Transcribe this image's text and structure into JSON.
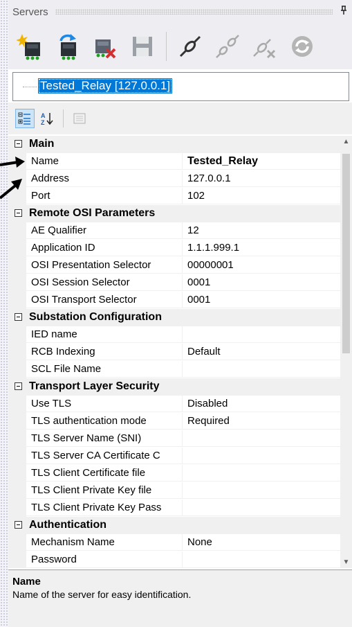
{
  "panel": {
    "title": "Servers",
    "pin_icon": "pin-icon"
  },
  "toolbar": {
    "buttons": [
      {
        "name": "new-server",
        "icon": "new-server-icon"
      },
      {
        "name": "import-server",
        "icon": "import-server-icon"
      },
      {
        "name": "delete-server",
        "icon": "delete-server-icon"
      },
      {
        "name": "save",
        "icon": "save-icon"
      },
      {
        "name": "connect",
        "icon": "connect-icon"
      },
      {
        "name": "connect-all",
        "icon": "connect-all-icon"
      },
      {
        "name": "disconnect",
        "icon": "disconnect-icon"
      },
      {
        "name": "refresh",
        "icon": "refresh-icon"
      }
    ]
  },
  "tree": {
    "selected_node": "Tested_Relay [127.0.0.1]"
  },
  "grid": {
    "categories": [
      {
        "label": "Main",
        "properties": [
          {
            "name": "Name",
            "value": "Tested_Relay",
            "bold": true
          },
          {
            "name": "Address",
            "value": "127.0.0.1"
          },
          {
            "name": "Port",
            "value": "102"
          }
        ]
      },
      {
        "label": "Remote OSI Parameters",
        "properties": [
          {
            "name": "AE Qualifier",
            "value": "12"
          },
          {
            "name": "Application ID",
            "value": "1.1.1.999.1"
          },
          {
            "name": "OSI Presentation Selector",
            "value": "00000001"
          },
          {
            "name": "OSI Session Selector",
            "value": "0001"
          },
          {
            "name": "OSI Transport Selector",
            "value": "0001"
          }
        ]
      },
      {
        "label": "Substation Configuration",
        "properties": [
          {
            "name": "IED name",
            "value": ""
          },
          {
            "name": "RCB Indexing",
            "value": "Default"
          },
          {
            "name": "SCL File Name",
            "value": ""
          }
        ]
      },
      {
        "label": "Transport Layer Security",
        "properties": [
          {
            "name": "Use TLS",
            "value": "Disabled"
          },
          {
            "name": "TLS authentication mode",
            "value": "Required"
          },
          {
            "name": "TLS Server Name (SNI)",
            "value": ""
          },
          {
            "name": "TLS Server CA Certificate C",
            "value": ""
          },
          {
            "name": "TLS Client Certificate file",
            "value": ""
          },
          {
            "name": "TLS Client Private Key file",
            "value": ""
          },
          {
            "name": "TLS Client Private Key Pass",
            "value": ""
          }
        ]
      },
      {
        "label": "Authentication",
        "properties": [
          {
            "name": "Mechanism Name",
            "value": "None"
          },
          {
            "name": "Password",
            "value": ""
          }
        ]
      }
    ]
  },
  "description": {
    "title": "Name",
    "text": "Name of the server for easy identification."
  }
}
